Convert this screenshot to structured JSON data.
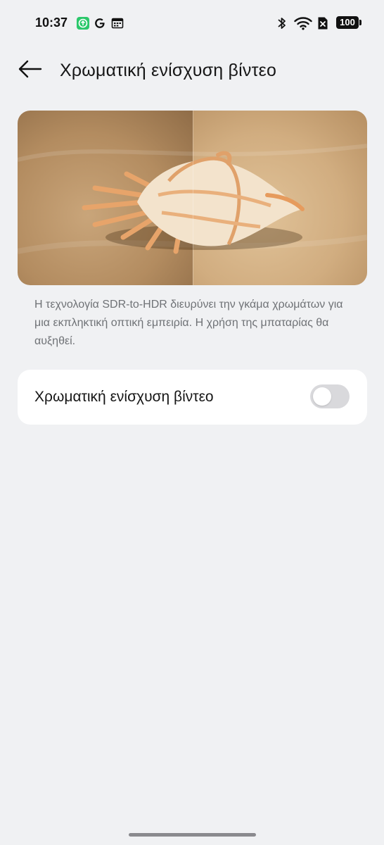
{
  "status_bar": {
    "time": "10:37",
    "left_icons": [
      "upload-app-icon",
      "google-icon",
      "calendar-icon"
    ],
    "right_icons": [
      "bluetooth-icon",
      "wifi-icon",
      "no-sim-icon"
    ],
    "battery": "100"
  },
  "header": {
    "back_icon": "arrow-left-icon",
    "title": "Χρωματική ενίσχυση βίντεο"
  },
  "preview": {
    "subject": "seashell on sand",
    "left_color": "#b38c60",
    "right_color": "#d1ad80"
  },
  "description": "Η τεχνολογία SDR-to-HDR διευρύνει την γκάμα χρωμάτων για μια εκπληκτική οπτική εμπειρία. Η χρήση της μπαταρίας θα αυξηθεί.",
  "setting": {
    "label": "Χρωματική ενίσχυση βίντεο",
    "enabled": false
  }
}
